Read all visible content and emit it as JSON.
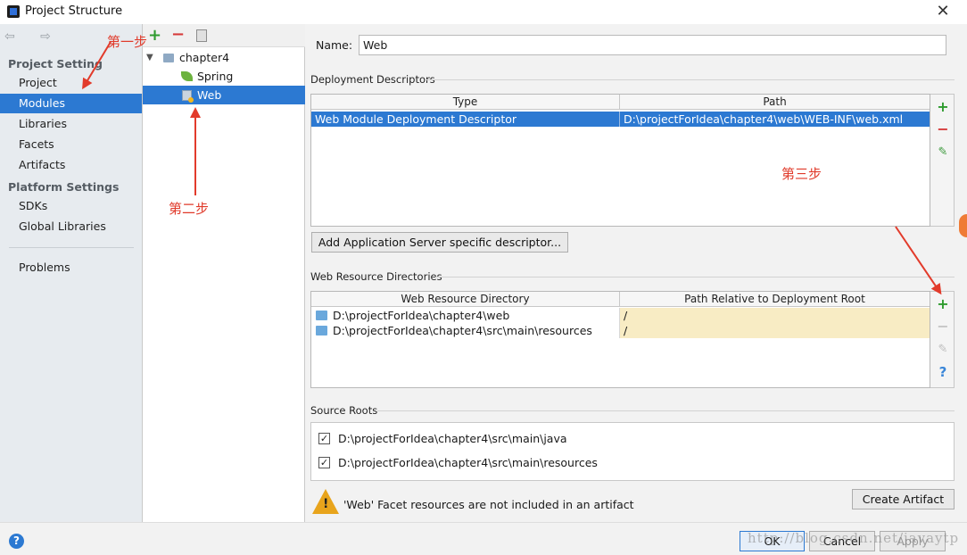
{
  "window": {
    "title": "Project Structure",
    "close_glyph": "✕"
  },
  "sidebar": {
    "back_forward": "⇦ ⇨",
    "project_settings": "Project Setting",
    "items_top": [
      {
        "label": "Project"
      },
      {
        "label": "Modules",
        "selected": true
      },
      {
        "label": "Libraries"
      },
      {
        "label": "Facets"
      },
      {
        "label": "Artifacts"
      }
    ],
    "platform_settings": "Platform Settings",
    "items_platform": [
      {
        "label": "SDKs"
      },
      {
        "label": "Global Libraries"
      }
    ],
    "problems": "Problems"
  },
  "tree": {
    "toolbar": {
      "add": "+",
      "remove": "−"
    },
    "nodes": [
      {
        "label": "chapter4",
        "icon": "module-folder-icon"
      },
      {
        "label": "Spring",
        "icon": "spring-leaf-icon"
      },
      {
        "label": "Web",
        "icon": "web-facet-icon",
        "selected": true
      }
    ]
  },
  "main": {
    "name_label": "Name:",
    "name_value": "Web",
    "deployment": {
      "section_title": "Deployment Descriptors",
      "columns": [
        "Type",
        "Path"
      ],
      "rows": [
        {
          "type": "Web Module Deployment Descriptor",
          "path": "D:\\projectForIdea\\chapter4\\web\\WEB-INF\\web.xml"
        }
      ],
      "add_server_button": "Add Application Server specific descriptor..."
    },
    "web_resources": {
      "section_title": "Web Resource Directories",
      "columns": [
        "Web Resource Directory",
        "Path Relative to Deployment Root"
      ],
      "rows": [
        {
          "dir": "D:\\projectForIdea\\chapter4\\web",
          "rel": "/"
        },
        {
          "dir": "D:\\projectForIdea\\chapter4\\src\\main\\resources",
          "rel": "/"
        }
      ]
    },
    "source_roots": {
      "section_title": "Source Roots",
      "rows": [
        {
          "path": "D:\\projectForIdea\\chapter4\\src\\main\\java",
          "checked": true
        },
        {
          "path": "D:\\projectForIdea\\chapter4\\src\\main\\resources",
          "checked": true
        }
      ]
    },
    "warning": "'Web' Facet resources are not included in an artifact",
    "create_artifact_button": "Create Artifact"
  },
  "tools": {
    "plus": "+",
    "minus": "−",
    "pencil": "✎",
    "help": "?"
  },
  "footer": {
    "help": "?",
    "ok": "OK",
    "cancel": "Cancel",
    "apply": "Apply"
  },
  "annotations": {
    "step1": "第一步",
    "step2": "第二步",
    "step3": "第三步"
  },
  "watermark": "http://blog.csdn.net/javaytp"
}
